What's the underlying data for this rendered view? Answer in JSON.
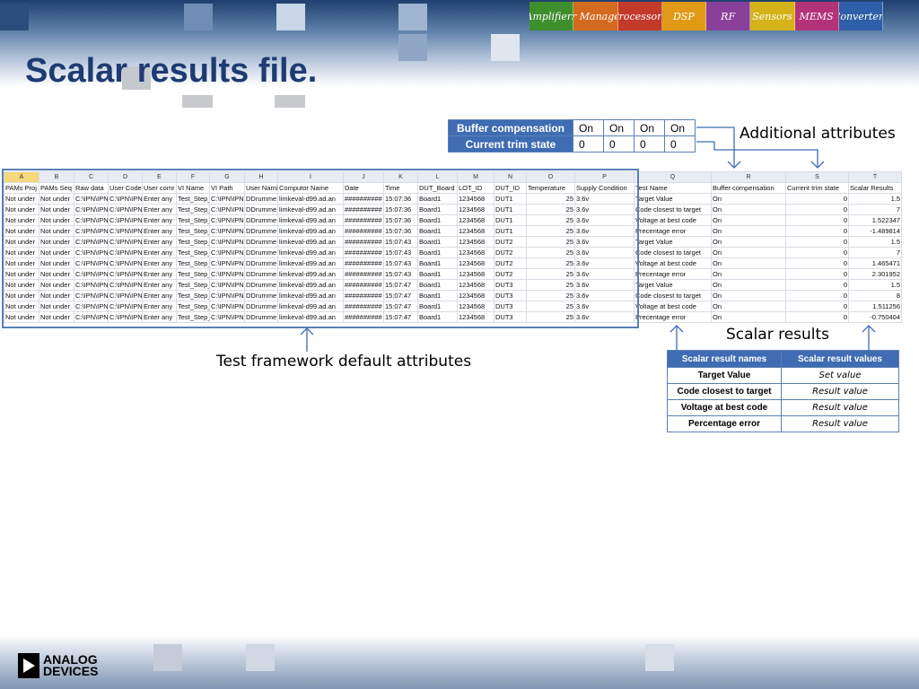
{
  "slide": {
    "title": "Scalar results file.",
    "banner_tabs": [
      "Amplifiers",
      "Power Management",
      "Processors",
      "DSP",
      "RF",
      "Sensors",
      "MEMS",
      "Converters"
    ]
  },
  "attributes_box": {
    "rows": [
      {
        "label": "Buffer compensation",
        "values": [
          "On",
          "On",
          "On",
          "On"
        ]
      },
      {
        "label": "Current trim state",
        "values": [
          "0",
          "0",
          "0",
          "0"
        ]
      }
    ]
  },
  "callouts": {
    "additional": "Additional attributes",
    "framework": "Test framework default attributes",
    "scalar": "Scalar results"
  },
  "spreadsheet": {
    "columns": [
      "A",
      "B",
      "C",
      "D",
      "E",
      "F",
      "G",
      "H",
      "I",
      "J",
      "K",
      "L",
      "M",
      "N",
      "O",
      "P",
      "Q",
      "R",
      "S",
      "T"
    ],
    "headers": [
      "PAMs Proj",
      "PAMs Seq",
      "Raw data",
      "User Code",
      "User comr",
      "VI Name",
      "VI Path",
      "User Nami",
      "Computor Name",
      "Date",
      "Time",
      "DUT_Board",
      "LOT_ID",
      "DUT_ID",
      "Temperature",
      "Supply Condition",
      "Test Name",
      "Buffer compensation",
      "Current trim state",
      "Scalar Results"
    ],
    "rows": [
      [
        "Not under",
        "Not under",
        "C:\\IPN\\IPN",
        "C:\\IPN\\IPN",
        "Enter any",
        "Test_Step_",
        "C:\\IPN\\IPN",
        "DDrumme",
        "limkeval-d99.ad.an",
        "##########",
        "15:07:36",
        "Board1",
        "1234568",
        "DUT1",
        "25",
        "3.6v",
        "Target Value",
        "On",
        "0",
        "1.5"
      ],
      [
        "Not under",
        "Not under",
        "C:\\IPN\\IPN",
        "C:\\IPN\\IPN",
        "Enter any",
        "Test_Step_",
        "C:\\IPN\\IPN",
        "DDrumme",
        "limkeval-d99.ad.an",
        "##########",
        "15:07:36",
        "Board1",
        "1234568",
        "DUT1",
        "25",
        "3.6v",
        "Code closest to target",
        "On",
        "0",
        "7"
      ],
      [
        "Not under",
        "Not under",
        "C:\\IPN\\IPN",
        "C:\\IPN\\IPN",
        "Enter any",
        "Test_Step_",
        "C:\\IPN\\IPN",
        "DDrumme",
        "limkeval-d99.ad.an",
        "##########",
        "15:07:36",
        "Board1",
        "1234568",
        "DUT1",
        "25",
        "3.6v",
        "Voltage at best code",
        "On",
        "0",
        "1.522347"
      ],
      [
        "Not under",
        "Not under",
        "C:\\IPN\\IPN",
        "C:\\IPN\\IPN",
        "Enter any",
        "Test_Step_",
        "C:\\IPN\\IPN",
        "DDrumme",
        "limkeval-d99.ad.an",
        "##########",
        "15:07:36",
        "Board1",
        "1234568",
        "DUT1",
        "25",
        "3.6v",
        "Precentage error",
        "On",
        "0",
        "-1.489814"
      ],
      [
        "Not under",
        "Not under",
        "C:\\IPN\\IPN",
        "C:\\IPN\\IPN",
        "Enter any",
        "Test_Step_",
        "C:\\IPN\\IPN",
        "DDrumme",
        "limkeval-d99.ad.an",
        "##########",
        "15:07:43",
        "Board1",
        "1234568",
        "DUT2",
        "25",
        "3.6v",
        "Target Value",
        "On",
        "0",
        "1.5"
      ],
      [
        "Not under",
        "Not under",
        "C:\\IPN\\IPN",
        "C:\\IPN\\IPN",
        "Enter any",
        "Test_Step_",
        "C:\\IPN\\IPN",
        "DDrumme",
        "limkeval-d99.ad.an",
        "##########",
        "15:07:43",
        "Board1",
        "1234568",
        "DUT2",
        "25",
        "3.6v",
        "Code closest to target",
        "On",
        "0",
        "7"
      ],
      [
        "Not under",
        "Not under",
        "C:\\IPN\\IPN",
        "C:\\IPN\\IPN",
        "Enter any",
        "Test_Step_",
        "C:\\IPN\\IPN",
        "DDrumme",
        "limkeval-d99.ad.an",
        "##########",
        "15:07:43",
        "Board1",
        "1234568",
        "DUT2",
        "25",
        "3.6v",
        "Voltage at best code",
        "On",
        "0",
        "1.465471"
      ],
      [
        "Not under",
        "Not under",
        "C:\\IPN\\IPN",
        "C:\\IPN\\IPN",
        "Enter any",
        "Test_Step_",
        "C:\\IPN\\IPN",
        "DDrumme",
        "limkeval-d99.ad.an",
        "##########",
        "15:07:43",
        "Board1",
        "1234568",
        "DUT2",
        "25",
        "3.6v",
        "Precentage error",
        "On",
        "0",
        "2.301952"
      ],
      [
        "Not under",
        "Not under",
        "C:\\IPN\\IPN",
        "C:\\IPN\\IPN",
        "Enter any",
        "Test_Step_",
        "C:\\IPN\\IPN",
        "DDrumme",
        "limkeval-d99.ad.an",
        "##########",
        "15:07:47",
        "Board1",
        "1234568",
        "DUT3",
        "25",
        "3.6v",
        "Target Value",
        "On",
        "0",
        "1.5"
      ],
      [
        "Not under",
        "Not under",
        "C:\\IPN\\IPN",
        "C:\\IPN\\IPN",
        "Enter any",
        "Test_Step_",
        "C:\\IPN\\IPN",
        "DDrumme",
        "limkeval-d99.ad.an",
        "##########",
        "15:07:47",
        "Board1",
        "1234568",
        "DUT3",
        "25",
        "3.6v",
        "Code closest to target",
        "On",
        "0",
        "8"
      ],
      [
        "Not under",
        "Not under",
        "C:\\IPN\\IPN",
        "C:\\IPN\\IPN",
        "Enter any",
        "Test_Step_",
        "C:\\IPN\\IPN",
        "DDrumme",
        "limkeval-d99.ad.an",
        "##########",
        "15:07:47",
        "Board1",
        "1234568",
        "DUT3",
        "25",
        "3.6v",
        "Voltage at best code",
        "On",
        "0",
        "1.511256"
      ],
      [
        "Not under",
        "Not under",
        "C:\\IPN\\IPN",
        "C:\\IPN\\IPN",
        "Enter any",
        "Test_Step_",
        "C:\\IPN\\IPN",
        "DDrumme",
        "limkeval-d99.ad.an",
        "##########",
        "15:07:47",
        "Board1",
        "1234568",
        "DUT3",
        "25",
        "3.6v",
        "Precentage error",
        "On",
        "0",
        "-0.750404"
      ]
    ]
  },
  "scalar_table": {
    "headers": [
      "Scalar result names",
      "Scalar result values"
    ],
    "rows": [
      {
        "name": "Target Value",
        "value": "Set value"
      },
      {
        "name": "Code closest to target",
        "value": "Result value"
      },
      {
        "name": "Voltage at best code",
        "value": "Result value"
      },
      {
        "name": "Percentage error",
        "value": "Result value"
      }
    ]
  },
  "logo": {
    "text": "ANALOG\nDEVICES"
  },
  "colors": {
    "title": "#1f3b73",
    "table_header": "#3f6cb3",
    "frame": "#5a80b8",
    "selected_column": "#f6d77a"
  }
}
